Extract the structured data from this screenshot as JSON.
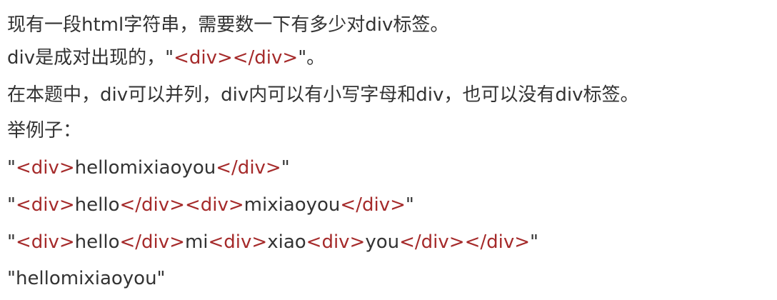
{
  "colors": {
    "text": "#333333",
    "tag": "#a52a2a",
    "background": "#ffffff"
  },
  "lines": [
    {
      "segments": [
        {
          "text": "现有一段html字符串，需要数一下有多少对div标签。",
          "style": "plain"
        }
      ]
    },
    {
      "segments": [
        {
          "text": "div是成对出现的，\"",
          "style": "plain"
        },
        {
          "text": "<div></div>",
          "style": "tag"
        },
        {
          "text": "\"。",
          "style": "plain"
        }
      ]
    },
    {
      "segments": [
        {
          "text": "在本题中，div可以并列，div内可以有小写字母和div，也可以没有div标签。",
          "style": "plain"
        }
      ]
    },
    {
      "segments": [
        {
          "text": "举例子：",
          "style": "plain"
        }
      ]
    },
    {
      "segments": [
        {
          "text": "\"",
          "style": "plain"
        },
        {
          "text": "<div>",
          "style": "tag"
        },
        {
          "text": "hellomixiaoyou",
          "style": "plain"
        },
        {
          "text": "</div>",
          "style": "tag"
        },
        {
          "text": "\"",
          "style": "plain"
        }
      ]
    },
    {
      "segments": [
        {
          "text": "\"",
          "style": "plain"
        },
        {
          "text": "<div>",
          "style": "tag"
        },
        {
          "text": "hello",
          "style": "plain"
        },
        {
          "text": "</div><div>",
          "style": "tag"
        },
        {
          "text": "mixiaoyou",
          "style": "plain"
        },
        {
          "text": "</div>",
          "style": "tag"
        },
        {
          "text": "\"",
          "style": "plain"
        }
      ]
    },
    {
      "segments": [
        {
          "text": "\"",
          "style": "plain"
        },
        {
          "text": "<div>",
          "style": "tag"
        },
        {
          "text": "hello",
          "style": "plain"
        },
        {
          "text": "</div>",
          "style": "tag"
        },
        {
          "text": "mi",
          "style": "plain"
        },
        {
          "text": "<div>",
          "style": "tag"
        },
        {
          "text": "xiao",
          "style": "plain"
        },
        {
          "text": "<div>",
          "style": "tag"
        },
        {
          "text": "you",
          "style": "plain"
        },
        {
          "text": "</div></div>",
          "style": "tag"
        },
        {
          "text": "\"",
          "style": "plain"
        }
      ]
    },
    {
      "segments": [
        {
          "text": "\"hellomixiaoyou\"",
          "style": "plain"
        }
      ]
    }
  ]
}
